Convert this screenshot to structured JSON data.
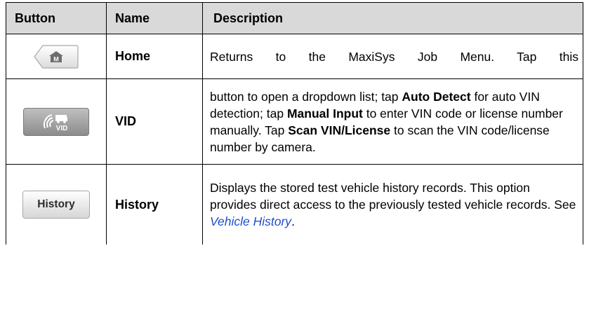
{
  "headers": {
    "button": "Button",
    "name": "Name",
    "description": "Description"
  },
  "rows": [
    {
      "name": "Home",
      "icon": "home-m-icon",
      "description": "Returns to the MaxiSys Job Menu. Tap this"
    },
    {
      "name": "VID",
      "icon": "vid-camera-icon",
      "icon_text": "VID",
      "description_parts": {
        "p1": "button to open a dropdown list; tap ",
        "b1": "Auto Detect",
        "p2": " for auto VIN detection; tap ",
        "b2": "Manual Input",
        "p3": " to enter VIN code or license number manually. Tap ",
        "b3": "Scan VIN/License",
        "p4": " to scan the VIN code/license number by camera."
      }
    },
    {
      "name": "History",
      "button_label": "History",
      "description_parts": {
        "p1": "Displays the stored test vehicle history records. This option provides direct access to the previously tested vehicle records. See ",
        "link": "Vehicle History",
        "p2": "."
      }
    }
  ],
  "colors": {
    "header_bg": "#d9d9d9",
    "link": "#1f4fd1",
    "border": "#000000"
  }
}
